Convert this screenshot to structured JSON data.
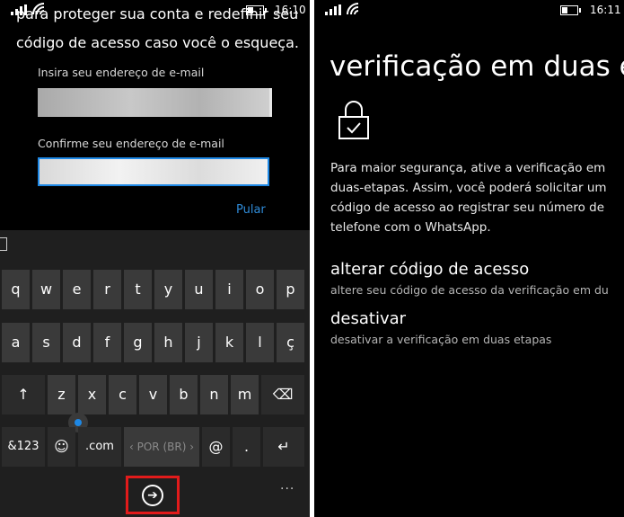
{
  "left_screen": {
    "status": {
      "time": "16:10",
      "icons": [
        "signal-icon",
        "wifi-icon",
        "battery-icon"
      ]
    },
    "intro_line1": "para proteger sua conta e redefinir seu",
    "intro_line2": "código de acesso caso você o esqueça.",
    "email_label": "Insira seu endereço de e-mail",
    "confirm_label": "Confirme seu endereço de e-mail",
    "skip_label": "Pular",
    "keyboard": {
      "row1": [
        "q",
        "w",
        "e",
        "r",
        "t",
        "y",
        "u",
        "i",
        "o",
        "p"
      ],
      "row2": [
        "a",
        "s",
        "d",
        "f",
        "g",
        "h",
        "j",
        "k",
        "l",
        "ç"
      ],
      "row3": [
        "z",
        "x",
        "c",
        "v",
        "b",
        "n",
        "m"
      ],
      "shift": "↑",
      "backspace": "⌫",
      "symbols": "&123",
      "emoji": "☺",
      "dotcom": ".com",
      "space": "‹ POR (BR) ›",
      "at": "@",
      "period": ".",
      "return": "↵",
      "enter": "➔",
      "more": "···"
    }
  },
  "right_screen": {
    "status": {
      "time": "16:11",
      "icons": [
        "signal-icon",
        "wifi-icon",
        "battery-icon"
      ]
    },
    "title": "verificação em duas e",
    "icon": "lock-check-icon",
    "description": "Para maior segurança, ative a verificação em duas-etapas. Assim, você poderá solicitar um código de acesso ao registrar seu número de telefone com o WhatsApp.",
    "options": [
      {
        "title": "alterar código de acesso",
        "subtitle": "altere seu código de acesso da verificação em du"
      },
      {
        "title": "desativar",
        "subtitle": "desativar a verificação em duas etapas"
      }
    ]
  },
  "colors": {
    "accent": "#1e88e5",
    "highlight": "#e21b1b",
    "skip_link": "#2f8bd8"
  }
}
